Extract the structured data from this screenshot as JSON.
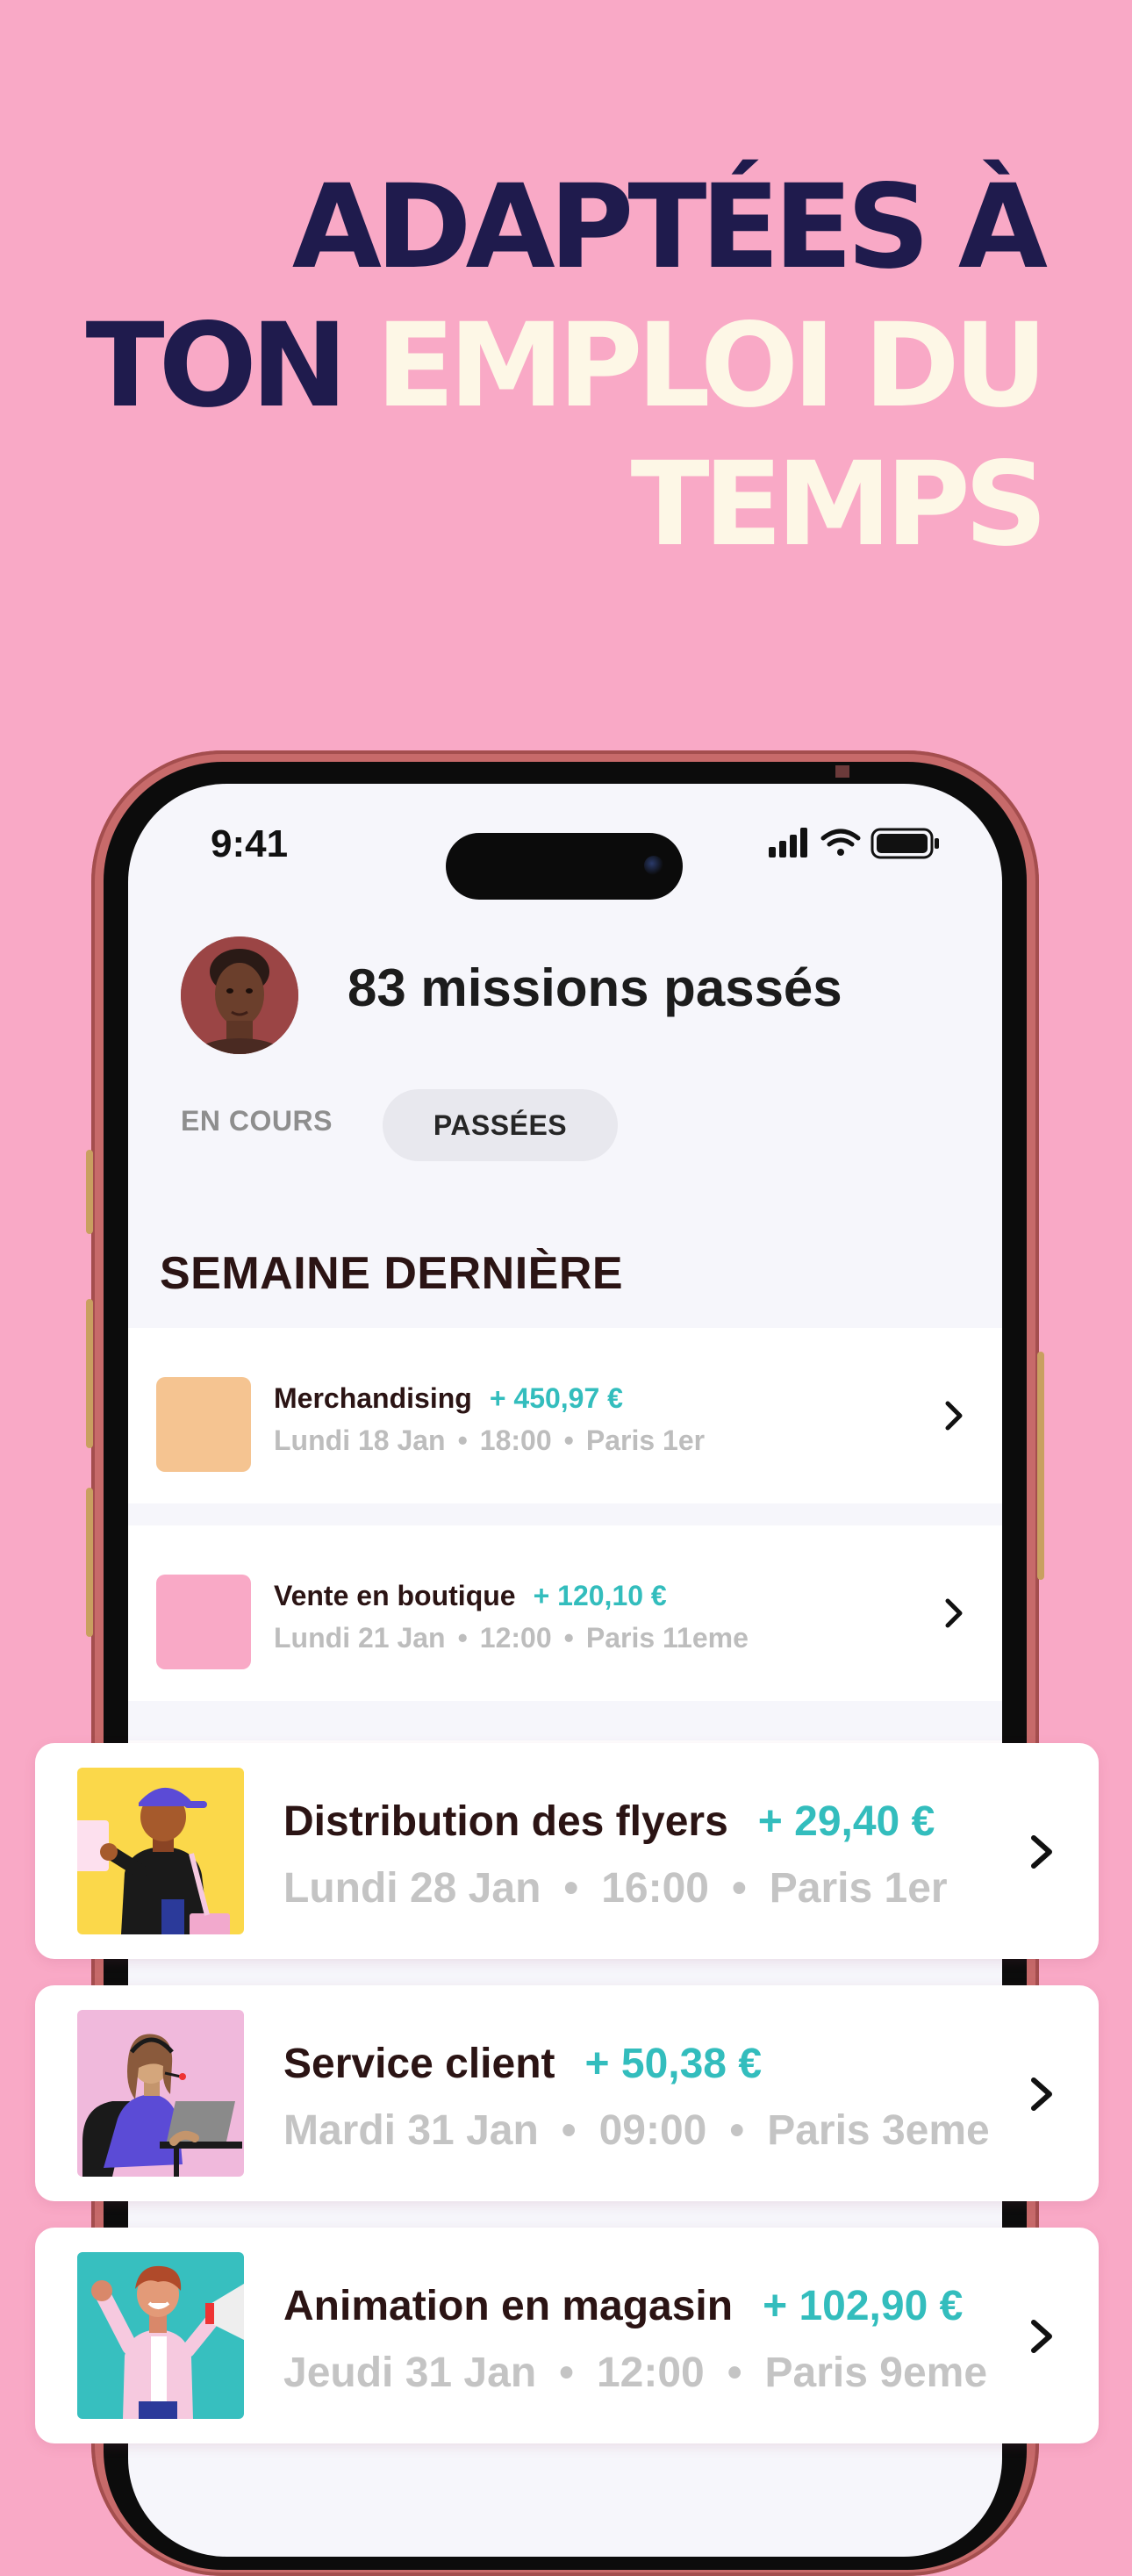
{
  "headline": {
    "line1": "ADAPTÉES À",
    "line2_dark": "TON",
    "line2_light": "EMPLOI DU",
    "line3": "TEMPS"
  },
  "status_bar": {
    "time": "9:41"
  },
  "profile": {
    "title": "83 missions passés"
  },
  "tabs": {
    "active_tab": "PASSÉES",
    "inactive_tab": "EN COURS"
  },
  "section": {
    "title": "SEMAINE DERNIÈRE"
  },
  "screen_missions": [
    {
      "name": "Merchandising",
      "amount": "+ 450,97 €",
      "date": "Lundi 18 Jan",
      "time": "18:00",
      "location": "Paris 1er",
      "thumb_color": "#f5c491"
    },
    {
      "name": "Vente en boutique",
      "amount": "+ 120,10 €",
      "date": "Lundi 21 Jan",
      "time": "12:00",
      "location": "Paris 11eme",
      "thumb_color": "#f9a9c6"
    }
  ],
  "cards": [
    {
      "name": "Distribution des flyers",
      "amount": "+ 29,40 €",
      "date": "Lundi 28 Jan",
      "time": "16:00",
      "location": "Paris 1er",
      "illustration": "flyer-distributor-illustration"
    },
    {
      "name": "Service client",
      "amount": "+ 50,38 €",
      "date": "Mardi 31 Jan",
      "time": "09:00",
      "location": "Paris 3eme",
      "illustration": "customer-service-illustration"
    },
    {
      "name": "Animation en magasin",
      "amount": "+ 102,90 €",
      "date": "Jeudi 31 Jan",
      "time": "12:00",
      "location": "Paris 9eme",
      "illustration": "store-animator-illustration"
    }
  ],
  "colors": {
    "background": "#f9a9c6",
    "headline_dark": "#1f1b4d",
    "headline_light": "#fdf7e6",
    "amount": "#33bdbd"
  },
  "dot_separator": "•"
}
